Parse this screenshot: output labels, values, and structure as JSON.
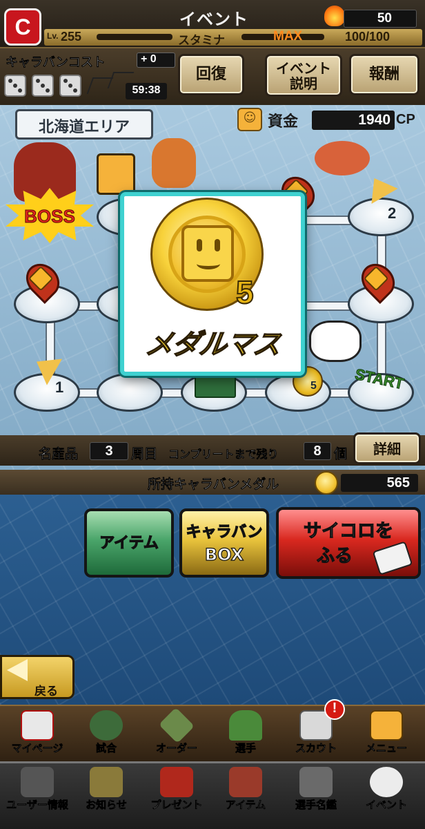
{
  "header": {
    "title": "イベント",
    "currency_value": "50",
    "level_label": "Lv.",
    "level_value": "255",
    "stamina_label": "スタミナ",
    "stamina_max_label": "MAX",
    "stamina_value": "100/100"
  },
  "caravan": {
    "cost_label": "キャラバンコスト",
    "cost_bonus": "+ 0",
    "timer": "59:38"
  },
  "top_buttons": {
    "recover": "回復",
    "event_line1": "イベント",
    "event_line2": "説明",
    "reward": "報酬"
  },
  "board": {
    "area_name": "北海道エリア",
    "funds_label": "資金",
    "funds_value": "1940",
    "funds_unit": "CP",
    "boss_label": "BOSS",
    "tile_number_1": "1",
    "tile_number_2": "2",
    "tile_medal_number": "5",
    "start_label": "START"
  },
  "modal": {
    "medal_number": "5",
    "title": "メダルマス"
  },
  "stats": {
    "specialty_label": "名産品",
    "specialty_value": "3",
    "laps_label": "周目",
    "remaining_label": "コンプリートまで残り",
    "remaining_value": "8",
    "remaining_unit": "個",
    "detail_button": "詳細"
  },
  "medal_row": {
    "label": "所持キャラバンメダル",
    "value": "565"
  },
  "actions": {
    "item": "アイテム",
    "caravan_box_line1": "キャラバン",
    "caravan_box_line2": "BOX",
    "roll_line1": "サイコロを",
    "roll_line2": "ふる",
    "back": "戻る"
  },
  "nav_primary": [
    {
      "label": "マイページ"
    },
    {
      "label": "試合"
    },
    {
      "label": "オーダー"
    },
    {
      "label": "選手"
    },
    {
      "label": "スカウト"
    },
    {
      "label": "メニュー"
    }
  ],
  "nav_badge": "!",
  "nav_secondary": [
    {
      "label": "ユーザー情報"
    },
    {
      "label": "お知らせ"
    },
    {
      "label": "プレゼント"
    },
    {
      "label": "アイテム"
    },
    {
      "label": "選手名鑑"
    },
    {
      "label": "イベント"
    }
  ],
  "icons": {
    "logo": "C",
    "die_face": "dice-icon",
    "funds_face": "☺"
  },
  "colors": {
    "modal_border": "#3fd1d0",
    "medal_gold": "#f8d23b",
    "team_red": "#c8161e"
  }
}
